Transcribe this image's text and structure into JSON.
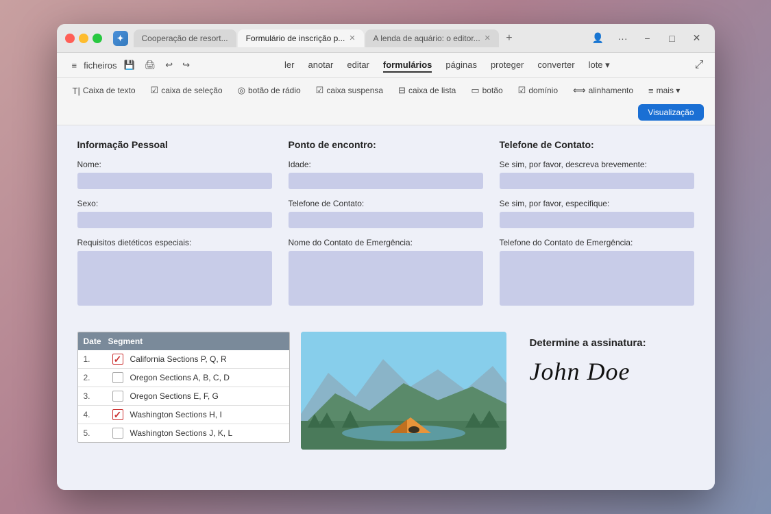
{
  "browser": {
    "tabs": [
      {
        "id": 1,
        "label": "Cooperação de resort...",
        "active": false,
        "closable": false
      },
      {
        "id": 2,
        "label": "Formulário de inscrição p...",
        "active": true,
        "closable": true
      },
      {
        "id": 3,
        "label": "A lenda de aquário: o editor...",
        "active": false,
        "closable": true
      }
    ],
    "add_tab_label": "+",
    "controls": [
      "···",
      "−",
      "□",
      "✕"
    ]
  },
  "toolbar": {
    "menu_icon": "≡",
    "file_label": "ficheiros",
    "icons": [
      "□",
      "⊡",
      "↩",
      "↪"
    ],
    "menu_items": [
      {
        "label": "ler",
        "id": "ler"
      },
      {
        "label": "anotar",
        "id": "anotar"
      },
      {
        "label": "editar",
        "id": "editar"
      },
      {
        "label": "formulários",
        "id": "formularios",
        "active": true
      },
      {
        "label": "páginas",
        "id": "paginas"
      },
      {
        "label": "proteger",
        "id": "proteger"
      },
      {
        "label": "converter",
        "id": "converter"
      },
      {
        "label": "lote",
        "id": "lote"
      }
    ],
    "external_link_icon": "⤢"
  },
  "form_toolbar": {
    "tools": [
      {
        "icon": "T",
        "label": "Caixa de texto"
      },
      {
        "icon": "☑",
        "label": "caixa de seleção"
      },
      {
        "icon": "◎",
        "label": "botão de rádio"
      },
      {
        "icon": "☑",
        "label": "caixa suspensa"
      },
      {
        "icon": "≡",
        "label": "caixa de lista"
      },
      {
        "icon": "▭",
        "label": "botão"
      },
      {
        "icon": "☑",
        "label": "domínio"
      },
      {
        "icon": "⟺",
        "label": "alinhamento"
      },
      {
        "icon": "≡",
        "label": "mais"
      }
    ],
    "preview_button": "Visualização"
  },
  "form": {
    "sections": {
      "personal": {
        "title": "Informação Pessoal",
        "fields": [
          {
            "label": "Nome:"
          },
          {
            "label": "Sexo:"
          },
          {
            "label": "Requisitos dietéticos especiais:"
          }
        ]
      },
      "meeting": {
        "title": "Ponto de encontro:",
        "fields": [
          {
            "label": "Idade:"
          },
          {
            "label": "Telefone de Contato:"
          },
          {
            "label": "Nome do Contato de Emergência:"
          }
        ]
      },
      "contact": {
        "title": "Telefone de Contato:",
        "fields": [
          {
            "label": "Se sim, por favor, descreva brevemente:"
          },
          {
            "label": "Se sim, por favor, especifique:"
          },
          {
            "label": "Telefone do Contato de Emergência:"
          }
        ]
      }
    },
    "table": {
      "headers": [
        "Date",
        "Segment"
      ],
      "rows": [
        {
          "num": "1.",
          "checked": true,
          "text": "California Sections P, Q, R"
        },
        {
          "num": "2.",
          "checked": false,
          "text": "Oregon Sections A, B, C, D"
        },
        {
          "num": "3.",
          "checked": false,
          "text": "Oregon Sections E, F, G"
        },
        {
          "num": "4.",
          "checked": true,
          "text": "Washington Sections H, I"
        },
        {
          "num": "5.",
          "checked": false,
          "text": "Washington Sections J, K, L"
        }
      ]
    },
    "signature": {
      "title": "Determine a assinatura:",
      "value": "John Doe"
    }
  }
}
